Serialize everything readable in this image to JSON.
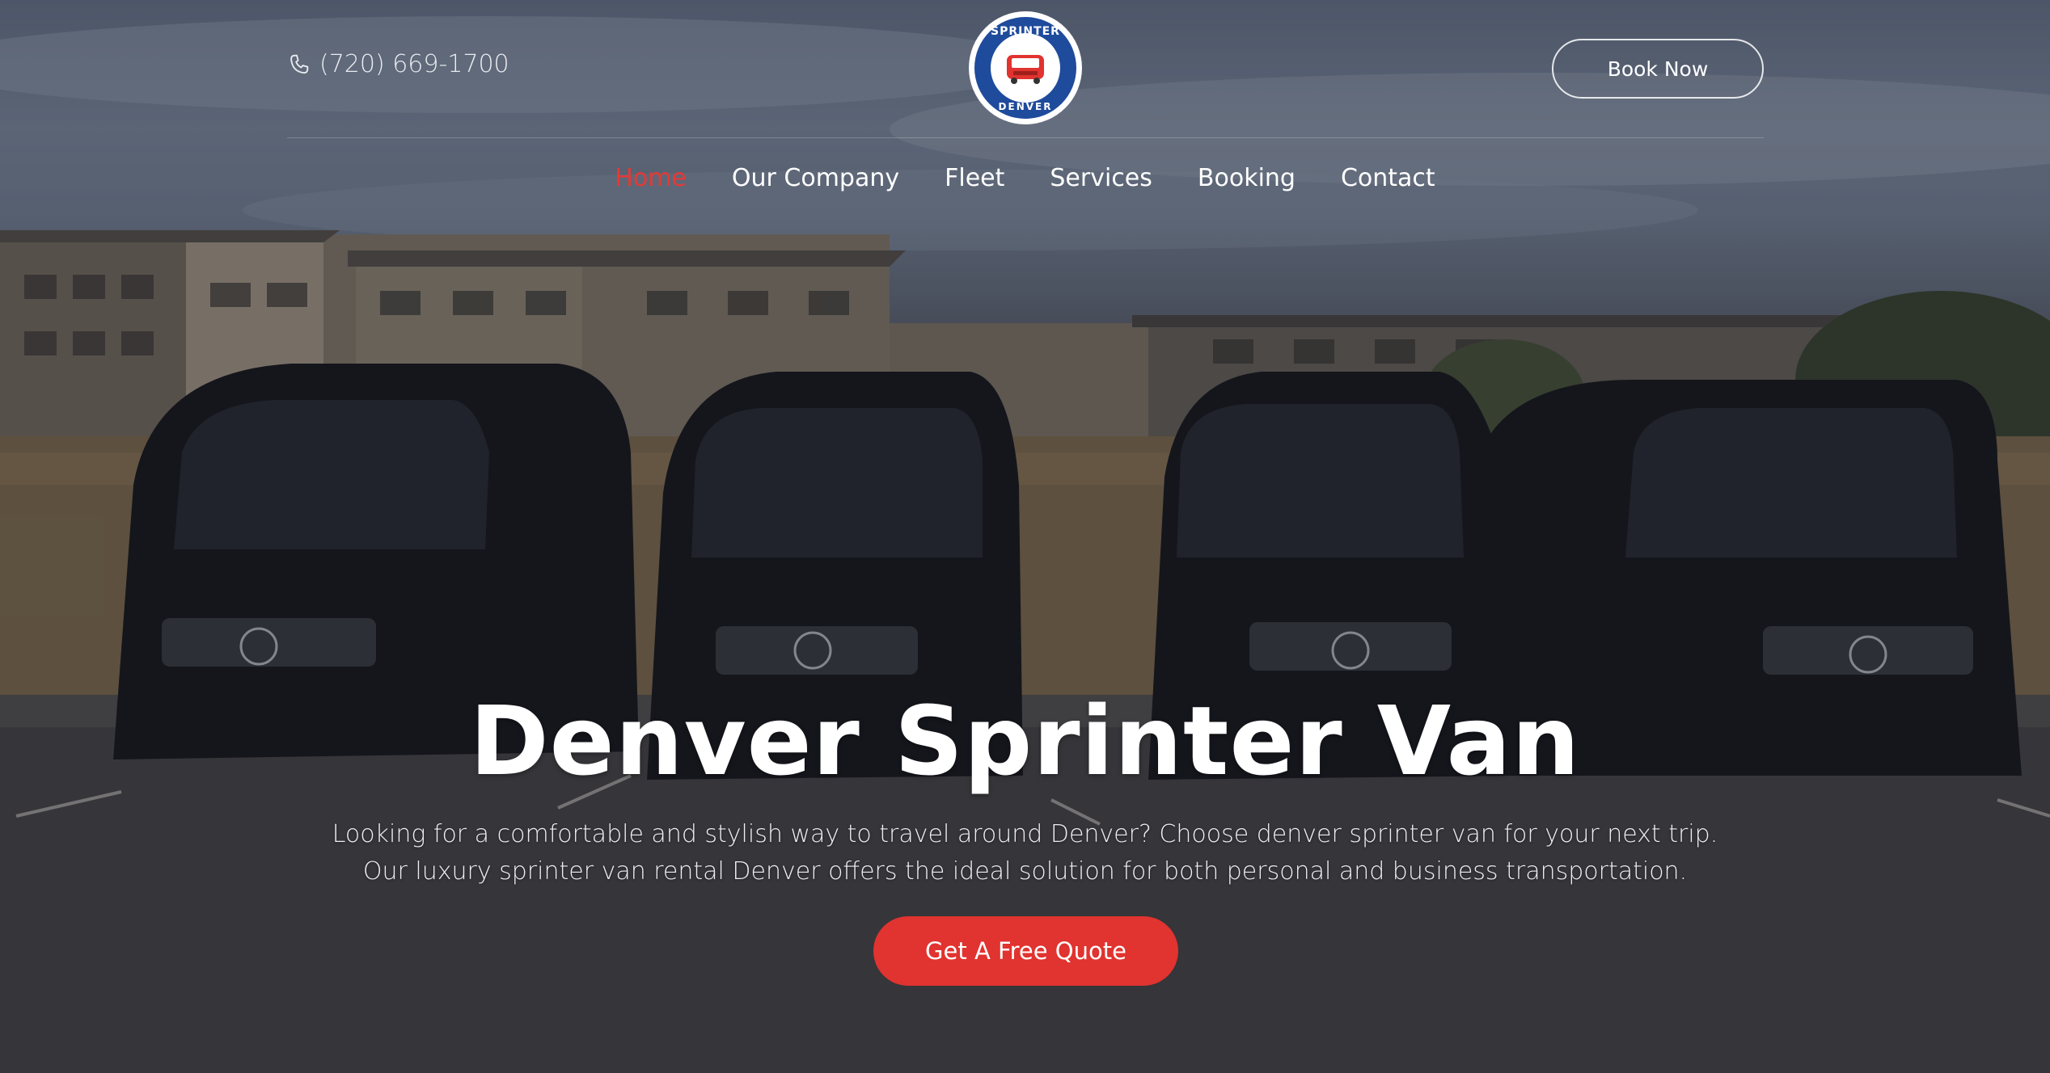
{
  "header": {
    "phone": "(720) 669-1700",
    "logo": {
      "text_top": "SPRINTER VAN",
      "text_bottom": "DENVER"
    },
    "book_now_label": "Book Now"
  },
  "nav": {
    "items": [
      {
        "label": "Home",
        "active": true
      },
      {
        "label": "Our Company",
        "active": false
      },
      {
        "label": "Fleet",
        "active": false
      },
      {
        "label": "Services",
        "active": false
      },
      {
        "label": "Booking",
        "active": false
      },
      {
        "label": "Contact",
        "active": false
      }
    ]
  },
  "hero": {
    "title": "Denver Sprinter Van",
    "description": "Looking for a comfortable and stylish way to travel around Denver? Choose denver sprinter van for your next trip. Our luxury sprinter van rental Denver offers the ideal solution for both personal and business transportation.",
    "cta_label": "Get A Free Quote"
  },
  "colors": {
    "accent": "#e1332f",
    "active_nav": "#e53935",
    "logo_blue": "#1f4b9c"
  },
  "icons": {
    "phone": "phone-icon",
    "logo_van": "van-icon"
  }
}
